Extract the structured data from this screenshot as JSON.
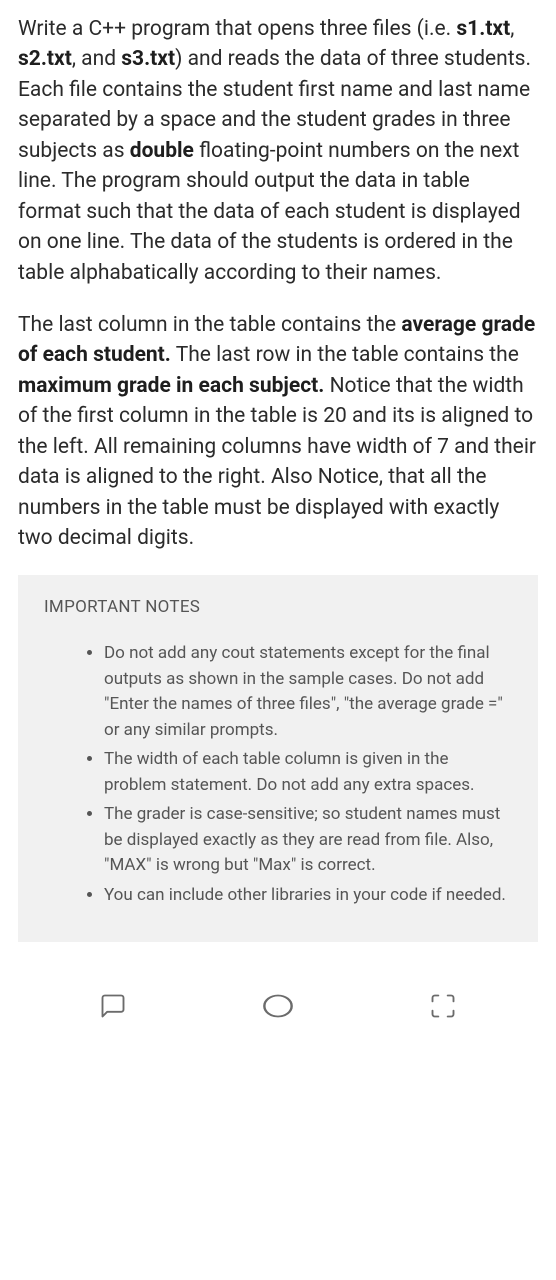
{
  "paragraph1": {
    "t1": "Write a C++ program that opens three files (i.e. ",
    "b1": "s1.txt",
    "t2": ", ",
    "b2": "s2.txt",
    "t3": ", and ",
    "b3": "s3.txt",
    "t4": ") and reads the data of three students. Each file contains the student first name and last name separated by a space and the student grades in three subjects as ",
    "b4": "double",
    "t5": " floating-point numbers on the next line. The program should output the data in table format such that the data of each student is displayed on one line. The data of the students is ordered in the table alphabatically according to their names."
  },
  "paragraph2": {
    "t1": "The last column in the table contains the ",
    "b1": "average grade of each student.",
    "t2": " The last row in the table contains the ",
    "b2": "maximum grade in each subject.",
    "t3": " Notice that the width of the first column in the table is 20 and its is aligned to the left. All remaining columns have width of 7 and their data is aligned to the right. Also Notice, that all the numbers in the table must be displayed with exactly two decimal digits."
  },
  "notes": {
    "title": "IMPORTANT NOTES",
    "items": [
      "Do not add any cout statements except for the final outputs as shown in the sample cases. Do not add \"Enter the names of three files\", \"the average grade =\" or any similar prompts.",
      "The width of each table column is given in the problem statement. Do not add any extra spaces.",
      "The grader is case-sensitive; so student names must be displayed exactly as they are read from file. Also, \"MAX\" is wrong but \"Max\" is correct.",
      "You can include other libraries in your code if needed."
    ]
  }
}
